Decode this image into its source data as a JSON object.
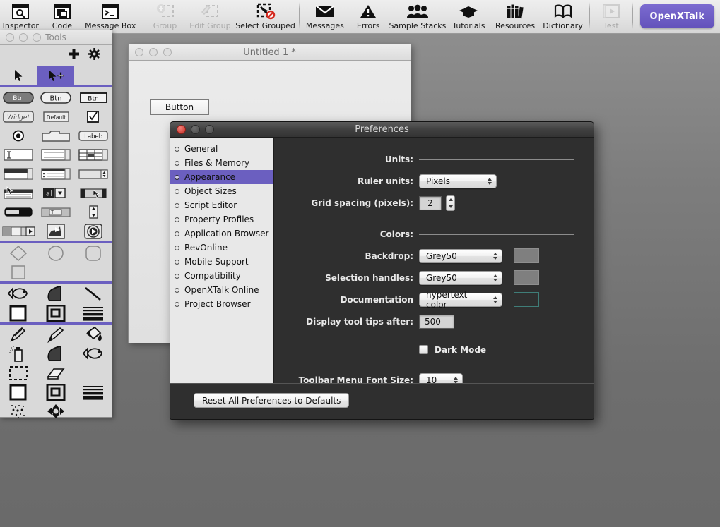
{
  "toolbar": {
    "items": [
      {
        "label": "Inspector",
        "icon": "inspector-icon",
        "enabled": true
      },
      {
        "label": "Code",
        "icon": "code-icon",
        "enabled": true
      },
      {
        "label": "Message Box",
        "icon": "message-box-icon",
        "enabled": true
      },
      {
        "label": "Group",
        "icon": "group-icon",
        "enabled": false
      },
      {
        "label": "Edit Group",
        "icon": "edit-group-icon",
        "enabled": false
      },
      {
        "label": "Select Grouped",
        "icon": "select-grouped-icon",
        "enabled": true
      },
      {
        "label": "Messages",
        "icon": "messages-icon",
        "enabled": true
      },
      {
        "label": "Errors",
        "icon": "errors-icon",
        "enabled": true
      },
      {
        "label": "Sample Stacks",
        "icon": "sample-stacks-icon",
        "enabled": true
      },
      {
        "label": "Tutorials",
        "icon": "tutorials-icon",
        "enabled": true
      },
      {
        "label": "Resources",
        "icon": "resources-icon",
        "enabled": true
      },
      {
        "label": "Dictionary",
        "icon": "dictionary-icon",
        "enabled": true
      },
      {
        "label": "Test",
        "icon": "test-icon",
        "enabled": false
      }
    ],
    "brand_label": "OpenXTalk",
    "brand_color": "#6C5CC4"
  },
  "tools_palette": {
    "title": "Tools",
    "add_icon": "plus-icon",
    "settings_icon": "gear-icon",
    "selected_tool": "browse-pointer-tool",
    "pointer_tools": [
      "arrow-pointer-tool",
      "browse-pointer-tool"
    ],
    "control_tools": [
      "rounded-button-tool",
      "oval-button-tool",
      "rect-button-tool",
      "widget-tool",
      "default-button-tool",
      "checkbox-tool",
      "radio-button-tool",
      "tab-panel-tool",
      "label-field-tool",
      "text-field-tool",
      "scrolling-list-field-tool",
      "table-field-tool",
      "combo-box-tool",
      "data-grid-tool",
      "spinner-field-tool",
      "list-select-tool",
      "menu-combo-tool",
      "scrollbar-tool",
      "progress-bar-tool",
      "option-menu-tool",
      "vertical-scrollbar-tool",
      "slider-tool",
      "player-tool",
      "video-player-tool"
    ],
    "shape_tools": [
      "diamond-shape-tool",
      "oval-shape-tool",
      "rounded-rect-tool",
      "square-shape-tool"
    ],
    "vector_tools": [
      "freeform-shape-tool",
      "polygon-tool",
      "line-tool",
      "filled-rect-tool",
      "framed-rect-tool",
      "line-width-tool"
    ],
    "paint_tools": [
      "pencil-tool",
      "brush-tool",
      "paint-bucket-tool",
      "spray-can-tool",
      "polygon-paint-tool",
      "curve-tool",
      "marquee-select-tool",
      "eraser-tool",
      "filled-rectangle-paint-tool",
      "framed-rectangle-paint-tool",
      "line-size-tool",
      "dither-pattern-tool",
      "rotate-tool"
    ]
  },
  "stack_window": {
    "title": "Untitled 1 *",
    "button_label": "Button"
  },
  "preferences": {
    "title": "Preferences",
    "sidebar": [
      {
        "label": "General",
        "active": false
      },
      {
        "label": "Files & Memory",
        "active": false
      },
      {
        "label": "Appearance",
        "active": true
      },
      {
        "label": "Object Sizes",
        "active": false
      },
      {
        "label": "Script Editor",
        "active": false
      },
      {
        "label": "Property Profiles",
        "active": false
      },
      {
        "label": "Application Browser",
        "active": false
      },
      {
        "label": "RevOnline",
        "active": false
      },
      {
        "label": "Mobile Support",
        "active": false
      },
      {
        "label": "Compatibility",
        "active": false
      },
      {
        "label": "OpenXTalk Online",
        "active": false
      },
      {
        "label": "Project Browser",
        "active": false
      }
    ],
    "section_units": "Units:",
    "ruler_units_label": "Ruler units:",
    "ruler_units_value": "Pixels",
    "grid_spacing_label": "Grid spacing (pixels):",
    "grid_spacing_value": "2",
    "section_colors": "Colors:",
    "backdrop_label": "Backdrop:",
    "backdrop_value": "Grey50",
    "backdrop_swatch": "#7f7f7f",
    "selection_handles_label": "Selection handles:",
    "selection_handles_value": "Grey50",
    "selection_handles_swatch": "#7f7f7f",
    "documentation_label": "Documentation",
    "documentation_value": "hypertext color",
    "documentation_swatch": "#2f2f2f",
    "documentation_swatch_border": "#3f7d78",
    "tooltips_label": "Display tool tips after:",
    "tooltips_value": "500",
    "dark_mode_label": "Dark Mode",
    "dark_mode_checked": false,
    "font_size_label": "Toolbar Menu Font Size:",
    "font_size_value": "10",
    "reset_button_label": "Reset All Preferences to Defaults",
    "accent_color": "#6B5FC0"
  }
}
